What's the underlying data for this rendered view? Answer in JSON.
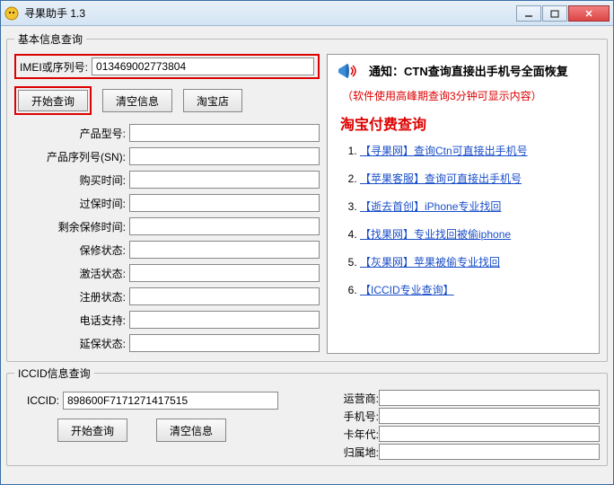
{
  "window": {
    "title": "寻果助手 1.3"
  },
  "basic": {
    "legend": "基本信息查询",
    "imei_label": "IMEI或序列号:",
    "imei_value": "013469002773804",
    "btn_start": "开始查询",
    "btn_clear": "清空信息",
    "btn_taobao": "淘宝店",
    "fields": {
      "product_model": "产品型号:",
      "product_sn": "产品序列号(SN):",
      "purchase_time": "购买时间:",
      "warranty_expire": "过保时间:",
      "remaining_warranty": "剩余保修时间:",
      "warranty_status": "保修状态:",
      "activation_status": "激活状态:",
      "registration_status": "注册状态:",
      "phone_support": "电话支持:",
      "extended_warranty": "延保状态:"
    }
  },
  "notice": {
    "title": "通知：CTN查询直接出手机号全面恢复",
    "subtitle": "（软件使用高峰期查询3分钟可显示内容）",
    "heading": "淘宝付费查询",
    "links": [
      "【寻果网】查询Ctn可直接出手机号",
      "【苹果客服】查询可直接出手机号",
      "【逝去首创】iPhone专业找回",
      "【找果网】专业找回被偷iphone",
      "【灰果网】苹果被偷专业找回",
      "【ICCID专业查询】"
    ]
  },
  "iccid": {
    "legend": "ICCID信息查询",
    "label": "ICCID:",
    "value": "898600F7171271417515",
    "btn_start": "开始查询",
    "btn_clear": "清空信息",
    "carrier_label": "运营商:",
    "phone_label": "手机号:",
    "card_year_label": "卡年代:",
    "region_label": "归属地:"
  }
}
